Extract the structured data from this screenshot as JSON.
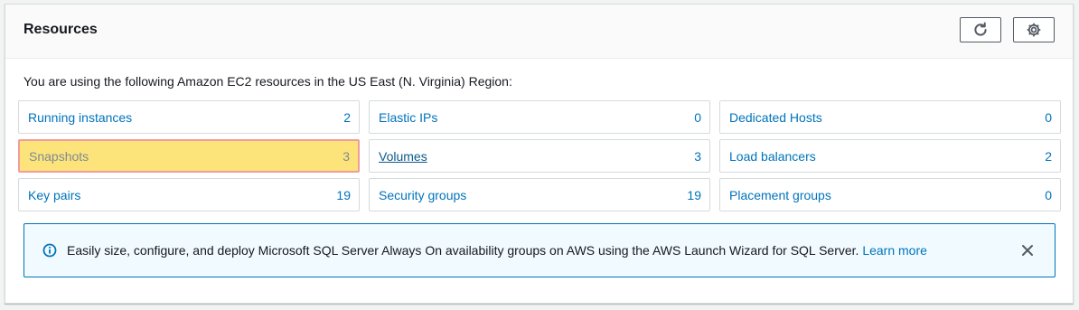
{
  "panel": {
    "title": "Resources",
    "refresh_icon": "refresh-icon",
    "settings_icon": "gear-icon"
  },
  "intro": "You are using the following Amazon EC2 resources in the US East (N. Virginia) Region:",
  "resources": [
    [
      {
        "label": "Running instances",
        "count": "2"
      },
      {
        "label": "Elastic IPs",
        "count": "0"
      },
      {
        "label": "Dedicated Hosts",
        "count": "0"
      }
    ],
    [
      {
        "label": "Snapshots",
        "count": "3"
      },
      {
        "label": "Volumes",
        "count": "3"
      },
      {
        "label": "Load balancers",
        "count": "2"
      }
    ],
    [
      {
        "label": "Key pairs",
        "count": "19"
      },
      {
        "label": "Security groups",
        "count": "19"
      },
      {
        "label": "Placement groups",
        "count": "0"
      }
    ]
  ],
  "info": {
    "icon": "info-icon",
    "text": "Easily size, configure, and deploy Microsoft SQL Server Always On availability groups on AWS using the AWS Launch Wizard for SQL Server. ",
    "link": "Learn more",
    "close_icon": "close-icon"
  },
  "colors": {
    "link": "#0073bb",
    "highlight_bg": "#fde47a",
    "highlight_border": "#f29c9c",
    "info_bg": "#f1faff"
  }
}
